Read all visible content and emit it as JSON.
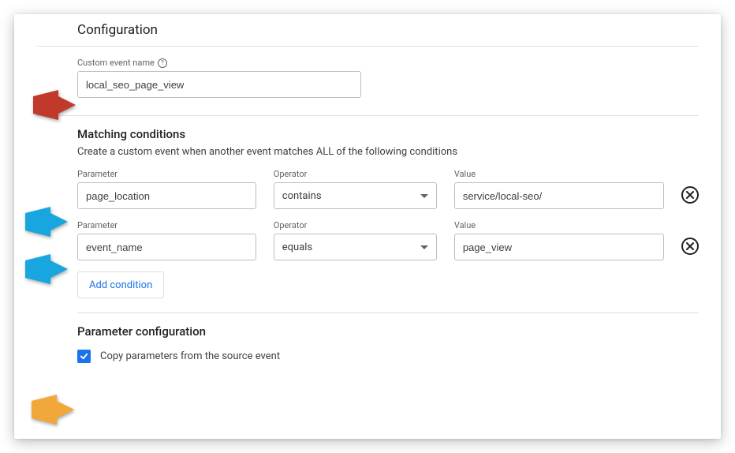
{
  "title": "Configuration",
  "custom_event": {
    "label": "Custom event name",
    "value": "local_seo_page_view"
  },
  "matching": {
    "heading": "Matching conditions",
    "description": "Create a custom event when another event matches ALL of the following conditions",
    "col_labels": {
      "parameter": "Parameter",
      "operator": "Operator",
      "value": "Value"
    },
    "rows": [
      {
        "parameter": "page_location",
        "operator": "contains",
        "value": "service/local-seo/"
      },
      {
        "parameter": "event_name",
        "operator": "equals",
        "value": "page_view"
      }
    ],
    "add_label": "Add condition"
  },
  "param_config": {
    "heading": "Parameter configuration",
    "copy_label": "Copy parameters from the source event",
    "copy_checked": true
  }
}
